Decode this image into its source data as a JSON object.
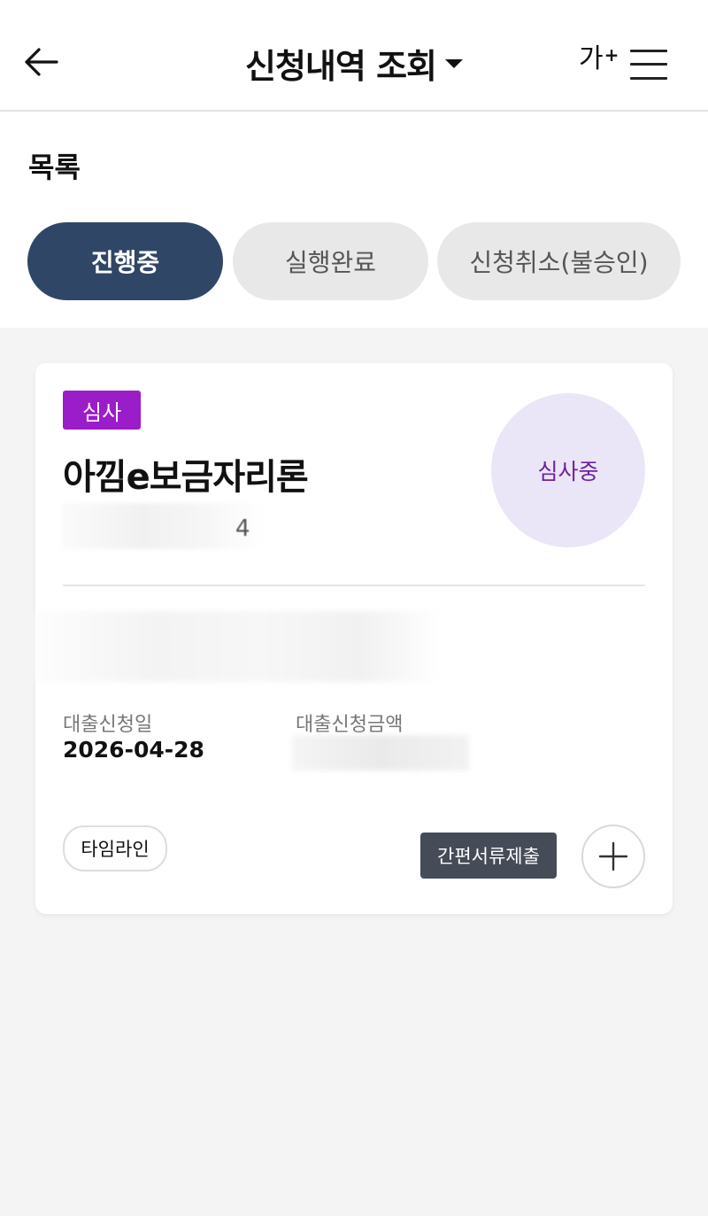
{
  "header": {
    "title": "신청내역 조회",
    "font_size_label": "가",
    "font_size_plus": "+",
    "back_icon": "arrow-left-icon",
    "menu_icon": "hamburger-menu-icon"
  },
  "list": {
    "section_title": "목록",
    "tabs": [
      {
        "label": "진행중",
        "active": true
      },
      {
        "label": "실행완료",
        "active": false
      },
      {
        "label": "신청취소(불승인)",
        "active": false
      }
    ]
  },
  "card": {
    "badge": "심사",
    "loan_name": "아낌e보금자리론",
    "status": "심사중",
    "application_date_label": "대출신청일",
    "application_date": "2026-04-28",
    "application_amount_label": "대출신청금액",
    "timeline_label": "타임라인",
    "submit_docs_label": "간편서류제출",
    "plus_icon": "plus-icon",
    "masked_tail": "4"
  },
  "colors": {
    "tab_active_bg": "#304667",
    "badge_bg": "#9b1cc9",
    "status_circle_bg": "#ebe5f8",
    "status_text": "#6f22a0",
    "submit_btn_bg": "#454b57"
  }
}
